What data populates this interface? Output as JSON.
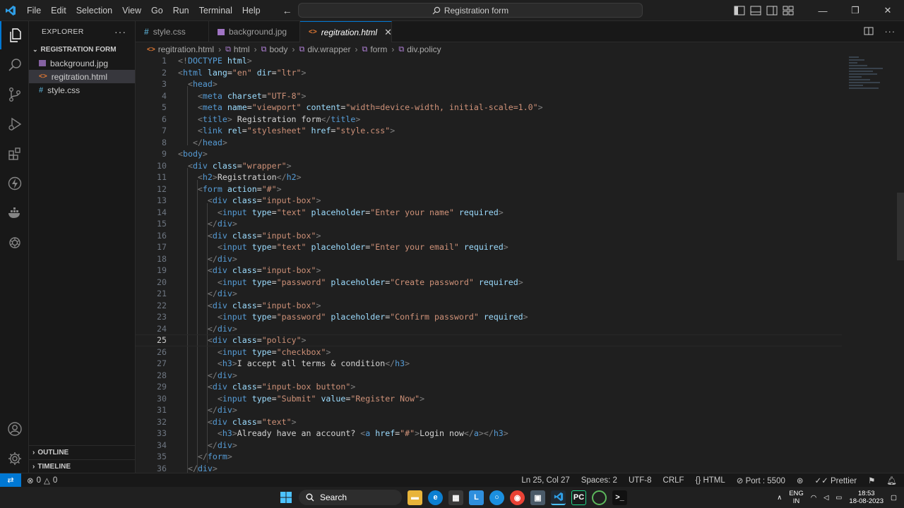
{
  "titlebar": {
    "menu": [
      "File",
      "Edit",
      "Selection",
      "View",
      "Go",
      "Run",
      "Terminal",
      "Help"
    ],
    "search_text": "Registration form"
  },
  "sidebar": {
    "header": "EXPLORER",
    "folder": "REGISTRATION FORM",
    "files": [
      {
        "name": "background.jpg",
        "icon": "image-file-icon"
      },
      {
        "name": "regitration.html",
        "icon": "html-file-icon"
      },
      {
        "name": "style.css",
        "icon": "css-file-icon"
      }
    ],
    "outline": "OUTLINE",
    "timeline": "TIMELINE"
  },
  "tabs": [
    {
      "label": "style.css",
      "icon": "#"
    },
    {
      "label": "background.jpg",
      "icon": "img"
    },
    {
      "label": "regitration.html",
      "icon": "<>"
    }
  ],
  "breadcrumb": [
    "regitration.html",
    "html",
    "body",
    "div.wrapper",
    "form",
    "div.policy"
  ],
  "editor": {
    "current_line": 25,
    "lines": [
      [
        [
          "t",
          "<!"
        ],
        [
          "n",
          "DOCTYPE"
        ],
        [
          "x",
          " "
        ],
        [
          "a",
          "html"
        ],
        [
          "t",
          ">"
        ]
      ],
      [
        [
          "t",
          "<"
        ],
        [
          "n",
          "html"
        ],
        [
          "x",
          " "
        ],
        [
          "a",
          "lang"
        ],
        [
          "x",
          "="
        ],
        [
          "s",
          "\"en\""
        ],
        [
          "x",
          " "
        ],
        [
          "a",
          "dir"
        ],
        [
          "x",
          "="
        ],
        [
          "s",
          "\"ltr\""
        ],
        [
          "t",
          ">"
        ]
      ],
      [
        [
          "x",
          "  "
        ],
        [
          "t",
          "<"
        ],
        [
          "n",
          "head"
        ],
        [
          "t",
          ">"
        ]
      ],
      [
        [
          "x",
          "    "
        ],
        [
          "t",
          "<"
        ],
        [
          "n",
          "meta"
        ],
        [
          "x",
          " "
        ],
        [
          "a",
          "charset"
        ],
        [
          "x",
          "="
        ],
        [
          "s",
          "\"UTF-8\""
        ],
        [
          "t",
          ">"
        ]
      ],
      [
        [
          "x",
          "    "
        ],
        [
          "t",
          "<"
        ],
        [
          "n",
          "meta"
        ],
        [
          "x",
          " "
        ],
        [
          "a",
          "name"
        ],
        [
          "x",
          "="
        ],
        [
          "s",
          "\"viewport\""
        ],
        [
          "x",
          " "
        ],
        [
          "a",
          "content"
        ],
        [
          "x",
          "="
        ],
        [
          "s",
          "\"width=device-width, initial-scale=1.0\""
        ],
        [
          "t",
          ">"
        ]
      ],
      [
        [
          "x",
          "    "
        ],
        [
          "t",
          "<"
        ],
        [
          "n",
          "title"
        ],
        [
          "t",
          ">"
        ],
        [
          "x",
          " Registration form"
        ],
        [
          "t",
          "</"
        ],
        [
          "n",
          "title"
        ],
        [
          "t",
          ">"
        ]
      ],
      [
        [
          "x",
          "    "
        ],
        [
          "t",
          "<"
        ],
        [
          "n",
          "link"
        ],
        [
          "x",
          " "
        ],
        [
          "a",
          "rel"
        ],
        [
          "x",
          "="
        ],
        [
          "s",
          "\"stylesheet\""
        ],
        [
          "x",
          " "
        ],
        [
          "a",
          "href"
        ],
        [
          "x",
          "="
        ],
        [
          "s",
          "\"style.css\""
        ],
        [
          "t",
          ">"
        ]
      ],
      [
        [
          "x",
          "   "
        ],
        [
          "t",
          "</"
        ],
        [
          "n",
          "head"
        ],
        [
          "t",
          ">"
        ]
      ],
      [
        [
          "t",
          "<"
        ],
        [
          "n",
          "body"
        ],
        [
          "t",
          ">"
        ]
      ],
      [
        [
          "x",
          "  "
        ],
        [
          "t",
          "<"
        ],
        [
          "n",
          "div"
        ],
        [
          "x",
          " "
        ],
        [
          "a",
          "class"
        ],
        [
          "x",
          "="
        ],
        [
          "s",
          "\"wrapper\""
        ],
        [
          "t",
          ">"
        ]
      ],
      [
        [
          "x",
          "    "
        ],
        [
          "t",
          "<"
        ],
        [
          "n",
          "h2"
        ],
        [
          "t",
          ">"
        ],
        [
          "x",
          "Registration"
        ],
        [
          "t",
          "</"
        ],
        [
          "n",
          "h2"
        ],
        [
          "t",
          ">"
        ]
      ],
      [
        [
          "x",
          "    "
        ],
        [
          "t",
          "<"
        ],
        [
          "n",
          "form"
        ],
        [
          "x",
          " "
        ],
        [
          "a",
          "action"
        ],
        [
          "x",
          "="
        ],
        [
          "s",
          "\"#\""
        ],
        [
          "t",
          ">"
        ]
      ],
      [
        [
          "x",
          "      "
        ],
        [
          "t",
          "<"
        ],
        [
          "n",
          "div"
        ],
        [
          "x",
          " "
        ],
        [
          "a",
          "class"
        ],
        [
          "x",
          "="
        ],
        [
          "s",
          "\"input-box\""
        ],
        [
          "t",
          ">"
        ]
      ],
      [
        [
          "x",
          "        "
        ],
        [
          "t",
          "<"
        ],
        [
          "n",
          "input"
        ],
        [
          "x",
          " "
        ],
        [
          "a",
          "type"
        ],
        [
          "x",
          "="
        ],
        [
          "s",
          "\"text\""
        ],
        [
          "x",
          " "
        ],
        [
          "a",
          "placeholder"
        ],
        [
          "x",
          "="
        ],
        [
          "s",
          "\"Enter your name\""
        ],
        [
          "x",
          " "
        ],
        [
          "a",
          "required"
        ],
        [
          "t",
          ">"
        ]
      ],
      [
        [
          "x",
          "      "
        ],
        [
          "t",
          "</"
        ],
        [
          "n",
          "div"
        ],
        [
          "t",
          ">"
        ]
      ],
      [
        [
          "x",
          "      "
        ],
        [
          "t",
          "<"
        ],
        [
          "n",
          "div"
        ],
        [
          "x",
          " "
        ],
        [
          "a",
          "class"
        ],
        [
          "x",
          "="
        ],
        [
          "s",
          "\"input-box\""
        ],
        [
          "t",
          ">"
        ]
      ],
      [
        [
          "x",
          "        "
        ],
        [
          "t",
          "<"
        ],
        [
          "n",
          "input"
        ],
        [
          "x",
          " "
        ],
        [
          "a",
          "type"
        ],
        [
          "x",
          "="
        ],
        [
          "s",
          "\"text\""
        ],
        [
          "x",
          " "
        ],
        [
          "a",
          "placeholder"
        ],
        [
          "x",
          "="
        ],
        [
          "s",
          "\"Enter your email\""
        ],
        [
          "x",
          " "
        ],
        [
          "a",
          "required"
        ],
        [
          "t",
          ">"
        ]
      ],
      [
        [
          "x",
          "      "
        ],
        [
          "t",
          "</"
        ],
        [
          "n",
          "div"
        ],
        [
          "t",
          ">"
        ]
      ],
      [
        [
          "x",
          "      "
        ],
        [
          "t",
          "<"
        ],
        [
          "n",
          "div"
        ],
        [
          "x",
          " "
        ],
        [
          "a",
          "class"
        ],
        [
          "x",
          "="
        ],
        [
          "s",
          "\"input-box\""
        ],
        [
          "t",
          ">"
        ]
      ],
      [
        [
          "x",
          "        "
        ],
        [
          "t",
          "<"
        ],
        [
          "n",
          "input"
        ],
        [
          "x",
          " "
        ],
        [
          "a",
          "type"
        ],
        [
          "x",
          "="
        ],
        [
          "s",
          "\"password\""
        ],
        [
          "x",
          " "
        ],
        [
          "a",
          "placeholder"
        ],
        [
          "x",
          "="
        ],
        [
          "s",
          "\"Create password\""
        ],
        [
          "x",
          " "
        ],
        [
          "a",
          "required"
        ],
        [
          "t",
          ">"
        ]
      ],
      [
        [
          "x",
          "      "
        ],
        [
          "t",
          "</"
        ],
        [
          "n",
          "div"
        ],
        [
          "t",
          ">"
        ]
      ],
      [
        [
          "x",
          "      "
        ],
        [
          "t",
          "<"
        ],
        [
          "n",
          "div"
        ],
        [
          "x",
          " "
        ],
        [
          "a",
          "class"
        ],
        [
          "x",
          "="
        ],
        [
          "s",
          "\"input-box\""
        ],
        [
          "t",
          ">"
        ]
      ],
      [
        [
          "x",
          "        "
        ],
        [
          "t",
          "<"
        ],
        [
          "n",
          "input"
        ],
        [
          "x",
          " "
        ],
        [
          "a",
          "type"
        ],
        [
          "x",
          "="
        ],
        [
          "s",
          "\"password\""
        ],
        [
          "x",
          " "
        ],
        [
          "a",
          "placeholder"
        ],
        [
          "x",
          "="
        ],
        [
          "s",
          "\"Confirm password\""
        ],
        [
          "x",
          " "
        ],
        [
          "a",
          "required"
        ],
        [
          "t",
          ">"
        ]
      ],
      [
        [
          "x",
          "      "
        ],
        [
          "t",
          "</"
        ],
        [
          "n",
          "div"
        ],
        [
          "t",
          ">"
        ]
      ],
      [
        [
          "x",
          "      "
        ],
        [
          "t",
          "<"
        ],
        [
          "n",
          "div"
        ],
        [
          "x",
          " "
        ],
        [
          "a",
          "class"
        ],
        [
          "x",
          "="
        ],
        [
          "s",
          "\"policy\""
        ],
        [
          "t",
          ">"
        ]
      ],
      [
        [
          "x",
          "        "
        ],
        [
          "t",
          "<"
        ],
        [
          "n",
          "input"
        ],
        [
          "x",
          " "
        ],
        [
          "a",
          "type"
        ],
        [
          "x",
          "="
        ],
        [
          "s",
          "\"checkbox\""
        ],
        [
          "t",
          ">"
        ]
      ],
      [
        [
          "x",
          "        "
        ],
        [
          "t",
          "<"
        ],
        [
          "n",
          "h3"
        ],
        [
          "t",
          ">"
        ],
        [
          "x",
          "I accept all terms & condition"
        ],
        [
          "t",
          "</"
        ],
        [
          "n",
          "h3"
        ],
        [
          "t",
          ">"
        ]
      ],
      [
        [
          "x",
          "      "
        ],
        [
          "t",
          "</"
        ],
        [
          "n",
          "div"
        ],
        [
          "t",
          ">"
        ]
      ],
      [
        [
          "x",
          "      "
        ],
        [
          "t",
          "<"
        ],
        [
          "n",
          "div"
        ],
        [
          "x",
          " "
        ],
        [
          "a",
          "class"
        ],
        [
          "x",
          "="
        ],
        [
          "s",
          "\"input-box button\""
        ],
        [
          "t",
          ">"
        ]
      ],
      [
        [
          "x",
          "        "
        ],
        [
          "t",
          "<"
        ],
        [
          "n",
          "input"
        ],
        [
          "x",
          " "
        ],
        [
          "a",
          "type"
        ],
        [
          "x",
          "="
        ],
        [
          "s",
          "\"Submit\""
        ],
        [
          "x",
          " "
        ],
        [
          "a",
          "value"
        ],
        [
          "x",
          "="
        ],
        [
          "s",
          "\"Register Now\""
        ],
        [
          "t",
          ">"
        ]
      ],
      [
        [
          "x",
          "      "
        ],
        [
          "t",
          "</"
        ],
        [
          "n",
          "div"
        ],
        [
          "t",
          ">"
        ]
      ],
      [
        [
          "x",
          "      "
        ],
        [
          "t",
          "<"
        ],
        [
          "n",
          "div"
        ],
        [
          "x",
          " "
        ],
        [
          "a",
          "class"
        ],
        [
          "x",
          "="
        ],
        [
          "s",
          "\"text\""
        ],
        [
          "t",
          ">"
        ]
      ],
      [
        [
          "x",
          "        "
        ],
        [
          "t",
          "<"
        ],
        [
          "n",
          "h3"
        ],
        [
          "t",
          ">"
        ],
        [
          "x",
          "Already have an account? "
        ],
        [
          "t",
          "<"
        ],
        [
          "n",
          "a"
        ],
        [
          "x",
          " "
        ],
        [
          "a",
          "href"
        ],
        [
          "x",
          "="
        ],
        [
          "s",
          "\"#\""
        ],
        [
          "t",
          ">"
        ],
        [
          "x",
          "Login now"
        ],
        [
          "t",
          "</"
        ],
        [
          "n",
          "a"
        ],
        [
          "t",
          "></"
        ],
        [
          "n",
          "h3"
        ],
        [
          "t",
          ">"
        ]
      ],
      [
        [
          "x",
          "      "
        ],
        [
          "t",
          "</"
        ],
        [
          "n",
          "div"
        ],
        [
          "t",
          ">"
        ]
      ],
      [
        [
          "x",
          "    "
        ],
        [
          "t",
          "</"
        ],
        [
          "n",
          "form"
        ],
        [
          "t",
          ">"
        ]
      ],
      [
        [
          "x",
          "  "
        ],
        [
          "t",
          "</"
        ],
        [
          "n",
          "div"
        ],
        [
          "t",
          ">"
        ]
      ]
    ]
  },
  "statusbar": {
    "errors": "0",
    "warnings": "0",
    "position": "Ln 25, Col 27",
    "spaces": "Spaces: 2",
    "encoding": "UTF-8",
    "eol": "CRLF",
    "language": "HTML",
    "port": "Port : 5500",
    "formatter": "Prettier"
  },
  "taskbar": {
    "search_label": "Search",
    "lang_top": "ENG",
    "lang_bottom": "IN",
    "time": "18:53",
    "date": "18-08-2023"
  },
  "colors": {
    "accent": "#0078d4",
    "tag": "#569cd6",
    "attribute": "#9cdcfe",
    "string": "#ce9178"
  }
}
